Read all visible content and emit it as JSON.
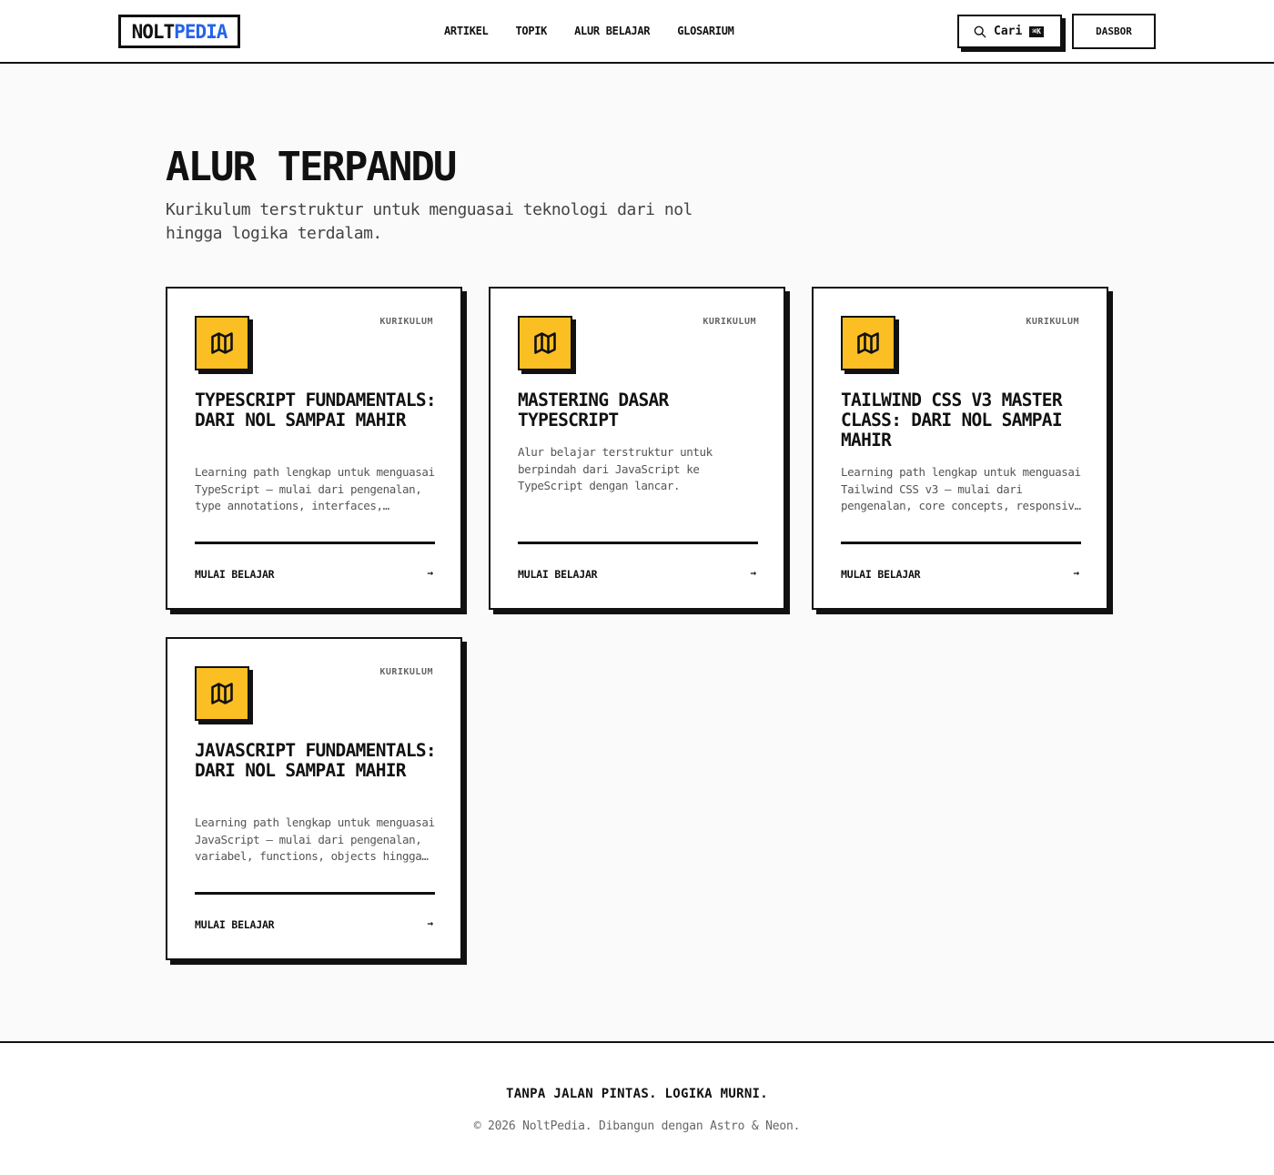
{
  "header": {
    "logo_part1": "NOLT",
    "logo_part2": "PEDIA",
    "nav": [
      "ARTIKEL",
      "TOPIK",
      "ALUR BELAJAR",
      "GLOSARIUM"
    ],
    "search_label": "Cari",
    "search_shortcut": "⌘K",
    "dashboard_label": "DASBOR"
  },
  "hero": {
    "title": "ALUR TERPANDU",
    "subtitle": "Kurikulum terstruktur untuk menguasai teknologi dari nol hingga logika terdalam."
  },
  "cards": [
    {
      "badge": "KURIKULUM",
      "icon": "map-icon",
      "title": "TYPESCRIPT FUNDAMENTALS: DARI NOL SAMPAI MAHIR",
      "description": "Learning path lengkap untuk menguasai TypeScript — mulai dari pengenalan, type annotations, interfaces, generics hingga advanced types.",
      "cta": "MULAI BELAJAR",
      "arrow": "→"
    },
    {
      "badge": "KURIKULUM",
      "icon": "map-icon",
      "title": "MASTERING DASAR TYPESCRIPT",
      "description": "Alur belajar terstruktur untuk berpindah dari JavaScript ke TypeScript dengan lancar.",
      "cta": "MULAI BELAJAR",
      "arrow": "→"
    },
    {
      "badge": "KURIKULUM",
      "icon": "map-icon",
      "title": "TAILWIND CSS V3 MASTER CLASS: DARI NOL SAMPAI MAHIR",
      "description": "Learning path lengkap untuk menguasai Tailwind CSS v3 — mulai dari pengenalan, core concepts, responsive design hingga kustomisasi.",
      "cta": "MULAI BELAJAR",
      "arrow": "→"
    },
    {
      "badge": "KURIKULUM",
      "icon": "map-icon",
      "title": "JAVASCRIPT FUNDAMENTALS: DARI NOL SAMPAI MAHIR",
      "description": "Learning path lengkap untuk menguasai JavaScript — mulai dari pengenalan, variabel, functions, objects hingga async programming.",
      "cta": "MULAI BELAJAR",
      "arrow": "→"
    }
  ],
  "footer": {
    "tagline": "TANPA JALAN PINTAS. LOGIKA MURNI.",
    "copyright": "© 2026 NoltPedia. Dibangun dengan Astro & Neon."
  },
  "colors": {
    "accent_yellow": "#fbbf24",
    "brand_blue": "#2563eb",
    "ink": "#111111",
    "page_bg": "#fafafa"
  }
}
